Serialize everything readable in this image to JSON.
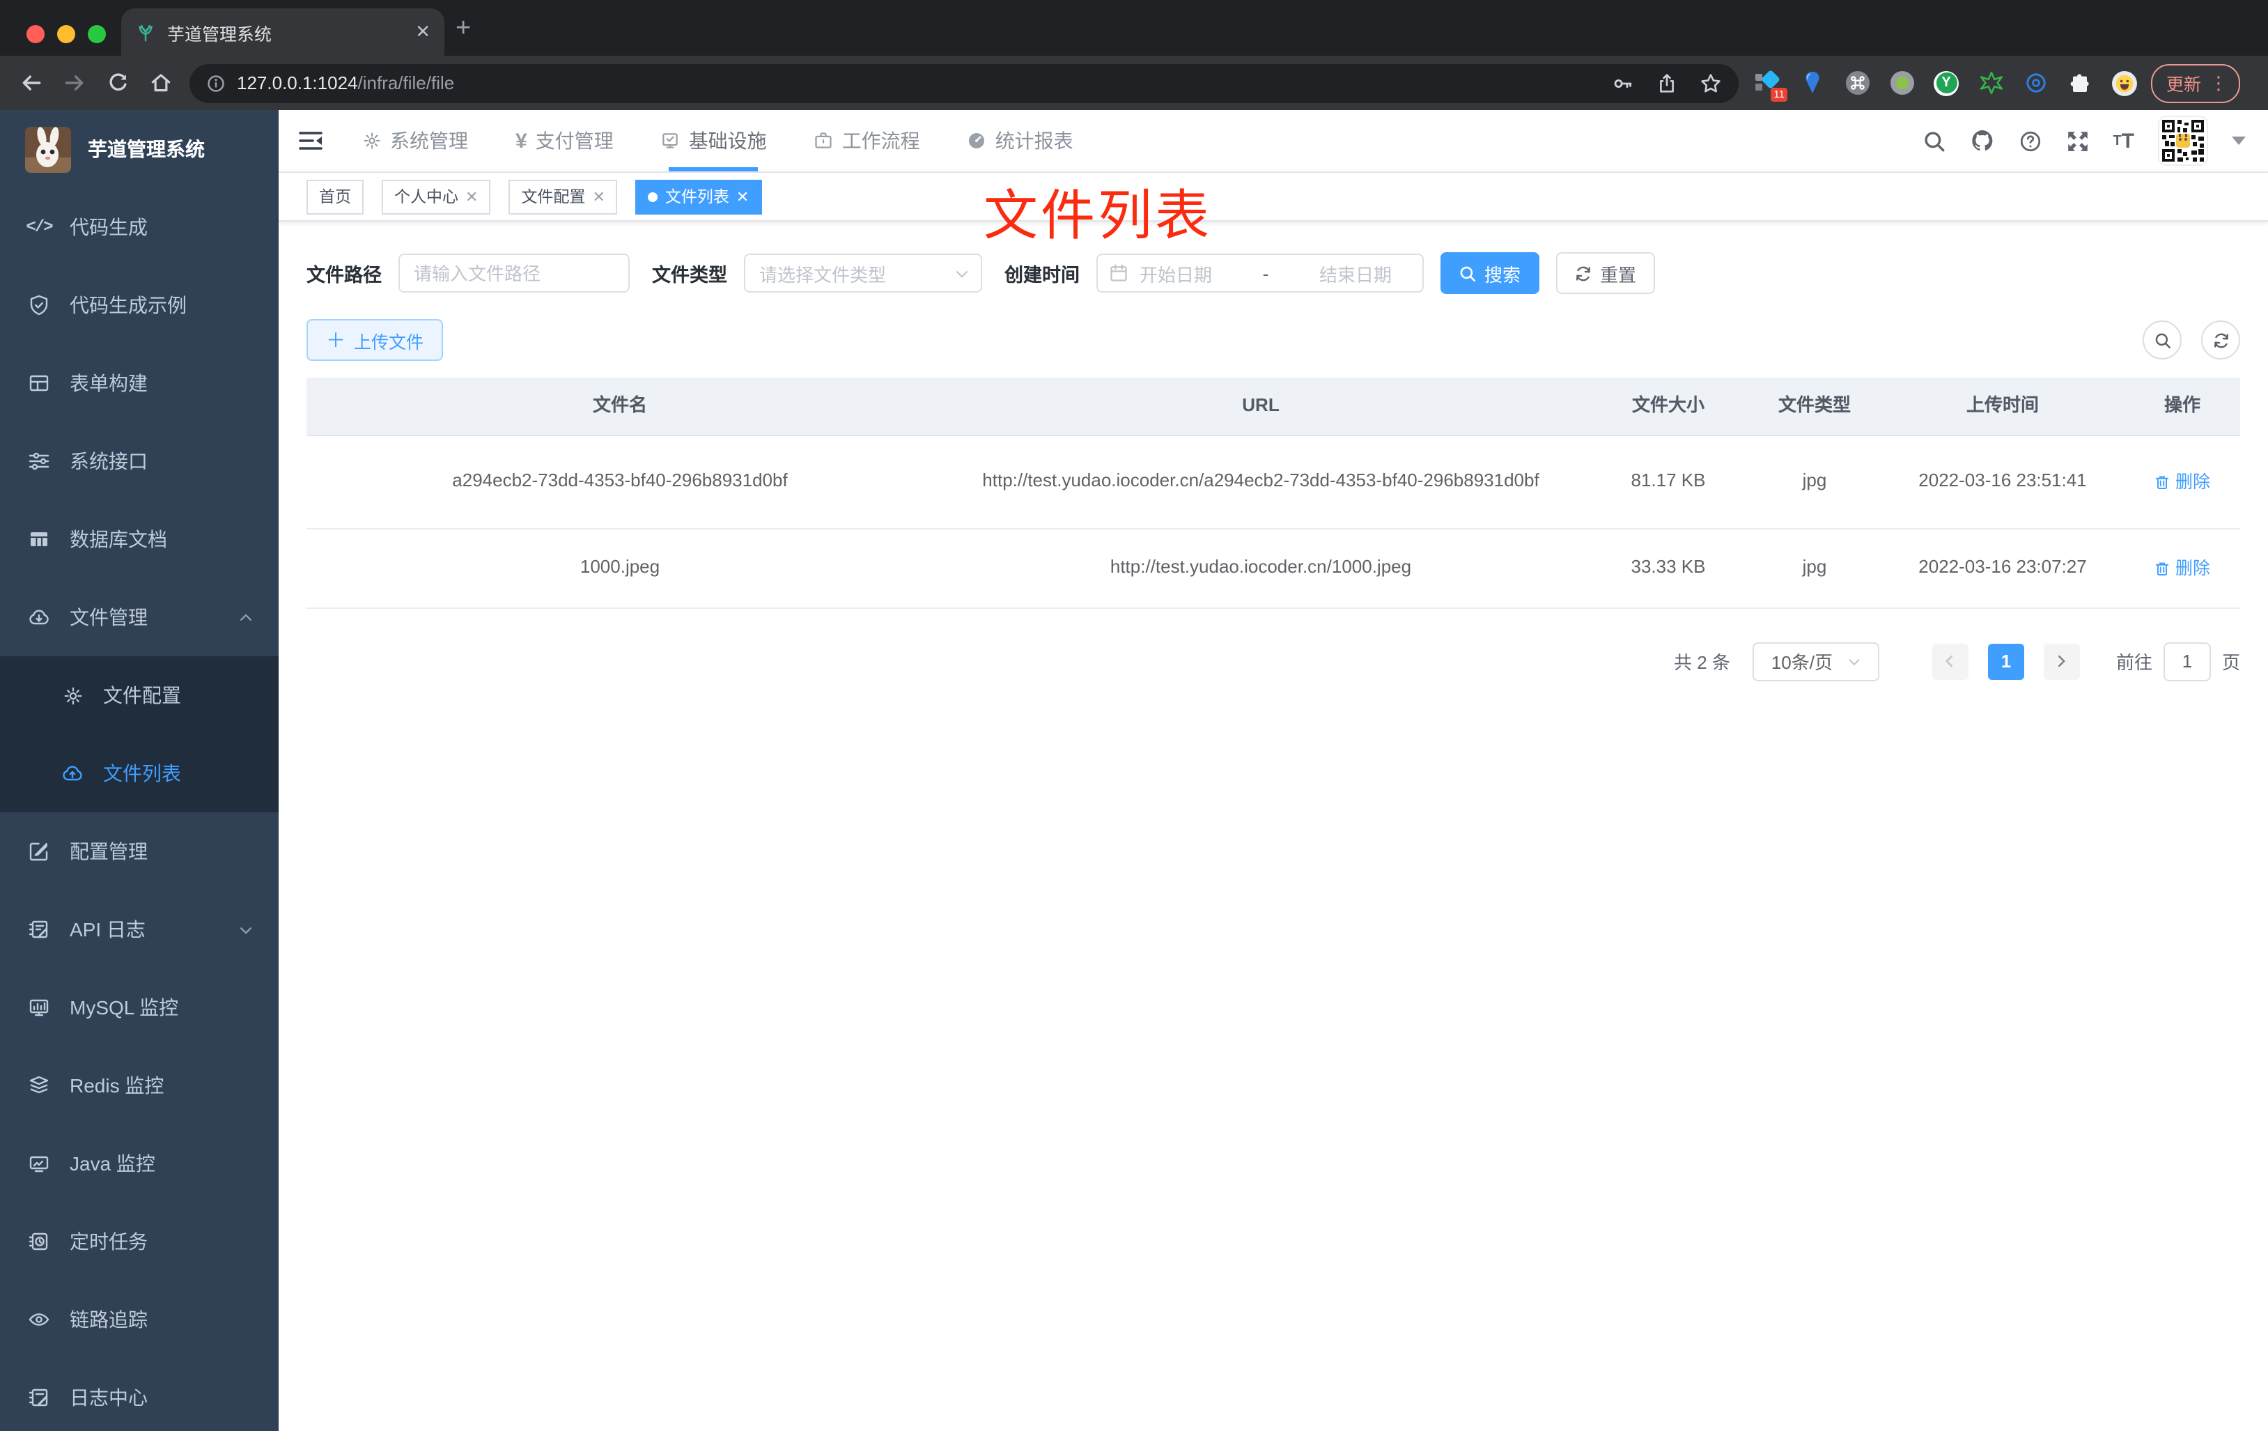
{
  "colors": {
    "accent": "#409eff",
    "annotation_red": "#fb2b10",
    "sidebar_bg": "#304156",
    "submenu_bg": "#1f2d3d",
    "table_header_bg": "#eef1f6"
  },
  "browser": {
    "tab_title": "芋道管理系统",
    "url_host": "127.0.0.1:1024",
    "url_path": "/infra/file/file",
    "update_label": "更新",
    "extension_badge": "11"
  },
  "app": {
    "logo_title": "芋道管理系统",
    "nav": [
      {
        "label": "系统管理"
      },
      {
        "label": "支付管理"
      },
      {
        "label": "基础设施",
        "active": true
      },
      {
        "label": "工作流程"
      },
      {
        "label": "统计报表"
      }
    ],
    "sidebar": [
      {
        "label": "代码生成"
      },
      {
        "label": "代码生成示例"
      },
      {
        "label": "表单构建"
      },
      {
        "label": "系统接口"
      },
      {
        "label": "数据库文档"
      },
      {
        "label": "文件管理",
        "expanded": true
      },
      {
        "label": "文件配置",
        "sub": true
      },
      {
        "label": "文件列表",
        "sub": true,
        "active": true
      },
      {
        "label": "配置管理"
      },
      {
        "label": "API 日志",
        "collapsed": true
      },
      {
        "label": "MySQL 监控"
      },
      {
        "label": "Redis 监控"
      },
      {
        "label": "Java 监控"
      },
      {
        "label": "定时任务"
      },
      {
        "label": "链路追踪"
      },
      {
        "label": "日志中心"
      }
    ],
    "tags": [
      {
        "label": "首页"
      },
      {
        "label": "个人中心",
        "closable": true
      },
      {
        "label": "文件配置",
        "closable": true
      },
      {
        "label": "文件列表",
        "closable": true,
        "active": true
      }
    ]
  },
  "annotation": "文件列表",
  "filters": {
    "path_label": "文件路径",
    "path_placeholder": "请输入文件路径",
    "type_label": "文件类型",
    "type_placeholder": "请选择文件类型",
    "date_label": "创建时间",
    "date_start": "开始日期",
    "date_separator": "-",
    "date_end": "结束日期",
    "search_label": "搜索",
    "reset_label": "重置"
  },
  "toolbar": {
    "upload_label": "上传文件"
  },
  "table": {
    "columns": [
      "文件名",
      "URL",
      "文件大小",
      "文件类型",
      "上传时间",
      "操作"
    ],
    "rows": [
      {
        "name": "a294ecb2-73dd-4353-bf40-296b8931d0bf",
        "url": "http://test.yudao.iocoder.cn/a294ecb2-73dd-4353-bf40-296b8931d0bf",
        "size": "81.17 KB",
        "type": "jpg",
        "time": "2022-03-16 23:51:41",
        "action": "删除"
      },
      {
        "name": "1000.jpeg",
        "url": "http://test.yudao.iocoder.cn/1000.jpeg",
        "size": "33.33 KB",
        "type": "jpg",
        "time": "2022-03-16 23:07:27",
        "action": "删除"
      }
    ]
  },
  "pagination": {
    "total": "共 2 条",
    "page_size": "10条/页",
    "current_page": "1",
    "goto_label": "前往",
    "goto_value": "1",
    "page_unit": "页"
  }
}
